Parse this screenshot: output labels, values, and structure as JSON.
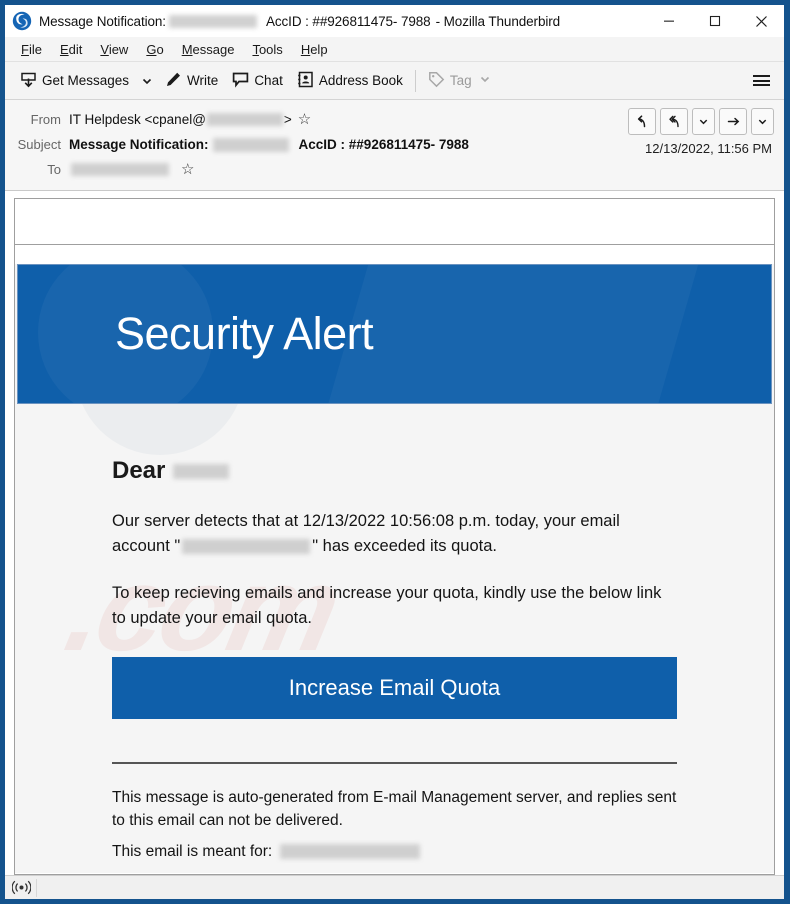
{
  "window": {
    "title_prefix": "Message Notification:",
    "title_mid": "AccID : ##926811475- 7988",
    "title_suffix": "- Mozilla Thunderbird",
    "app_icon": "thunderbird-icon",
    "minimize_label": "—",
    "maximize_label": "□",
    "close_label": "✕",
    "frame_color": "#14538d"
  },
  "menubar": {
    "items": [
      {
        "pre": "",
        "key": "F",
        "post": "ile"
      },
      {
        "pre": "",
        "key": "E",
        "post": "dit"
      },
      {
        "pre": "",
        "key": "V",
        "post": "iew"
      },
      {
        "pre": "",
        "key": "G",
        "post": "o"
      },
      {
        "pre": "",
        "key": "M",
        "post": "essage"
      },
      {
        "pre": "",
        "key": "T",
        "post": "ools"
      },
      {
        "pre": "",
        "key": "H",
        "post": "elp"
      }
    ]
  },
  "toolbar": {
    "get_messages": "Get Messages",
    "write": "Write",
    "chat": "Chat",
    "address_book": "Address Book",
    "tag": "Tag",
    "menu_icon": "hamburger-icon"
  },
  "message_header": {
    "from_label": "From",
    "from_value_prefix": "IT Helpdesk <cpanel@",
    "from_value_suffix": ">",
    "subject_label": "Subject",
    "subject_prefix": "Message Notification:",
    "subject_suffix": "AccID : ##926811475- 7988",
    "to_label": "To",
    "date": "12/13/2022, 11:56 PM",
    "actions": [
      "reply-icon",
      "reply-all-icon",
      "chevron-down-icon",
      "forward-icon",
      "chevron-down-icon"
    ]
  },
  "email": {
    "banner_title": "Security Alert",
    "banner_color": "#0f5faa",
    "greeting": "Dear",
    "paragraph1_part1": "Our server detects that at 12/13/2022 10:56:08 p.m.  today, your email",
    "paragraph1_part2_pre": "account \"",
    "paragraph1_part2_post": "\" has exceeded its quota.",
    "paragraph2": "To keep recieving emails and increase your quota, kindly use the below link to update your email quota.",
    "cta_label": "Increase Email Quota",
    "footer_line1": "This message is auto-generated from E-mail Management server, and replies sent to this email can not be delivered.",
    "footer_line2_label": "This email is meant for:"
  },
  "statusbar": {
    "icon": "broadcast-icon"
  }
}
